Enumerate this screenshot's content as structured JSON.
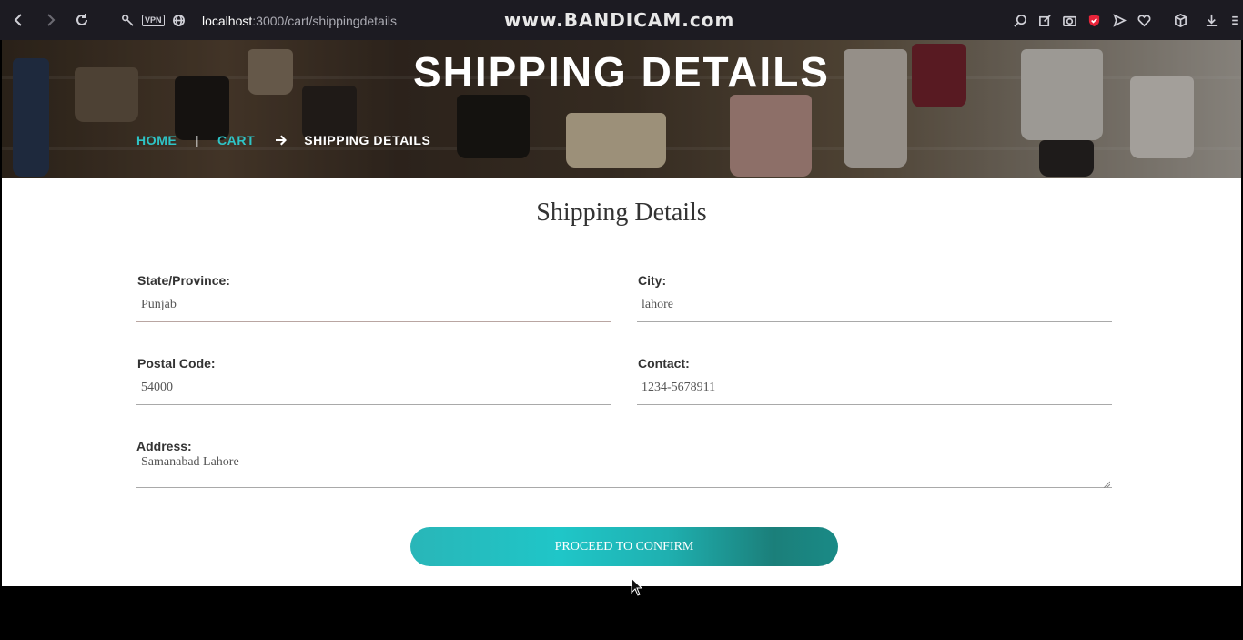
{
  "browser": {
    "url_host": "localhost",
    "url_rest": ":3000/cart/shippingdetails",
    "vpn_label": "VPN",
    "watermark": "www.BANDICAM.com",
    "icons": [
      "back-icon",
      "forward-icon",
      "reload-icon",
      "key-icon",
      "vpn-icon",
      "globe-icon",
      "search-icon",
      "edit-icon",
      "camera-icon",
      "shield-icon",
      "send-icon",
      "heart-icon",
      "cube-icon",
      "download-icon",
      "menu-icon"
    ],
    "shield_color": "#e8243a"
  },
  "hero": {
    "title": "SHIPPING DETAILS",
    "breadcrumb": {
      "home": "HOME",
      "separator": "|",
      "cart": "CART",
      "current": "SHIPPING DETAILS"
    }
  },
  "form": {
    "title": "Shipping Details",
    "state": {
      "label": "State/Province:",
      "value": "Punjab"
    },
    "city": {
      "label": "City:",
      "value": "lahore"
    },
    "postal": {
      "label": "Postal Code:",
      "value": "54000"
    },
    "contact": {
      "label": "Contact:",
      "value": "1234-5678911"
    },
    "address": {
      "label": "Address:",
      "value": "Samanabad Lahore"
    },
    "submit_label": "PROCEED TO CONFIRM"
  },
  "colors": {
    "accent": "#2ec4c6",
    "button_start": "#29b6b8",
    "button_end": "#1a8a86",
    "chrome_bg": "#1c1b22"
  }
}
